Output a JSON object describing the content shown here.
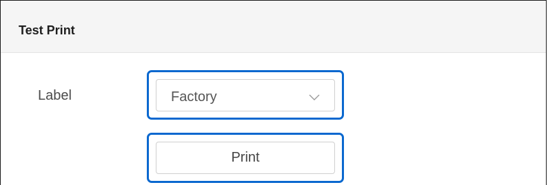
{
  "panel": {
    "title": "Test Print"
  },
  "form": {
    "label_field": {
      "label": "Label",
      "selected_value": "Factory"
    },
    "print_button_label": "Print"
  },
  "icons": {
    "dropdown": "chevron-down-icon"
  },
  "colors": {
    "focus_ring": "#0a68cf",
    "header_background": "#f5f5f5"
  }
}
